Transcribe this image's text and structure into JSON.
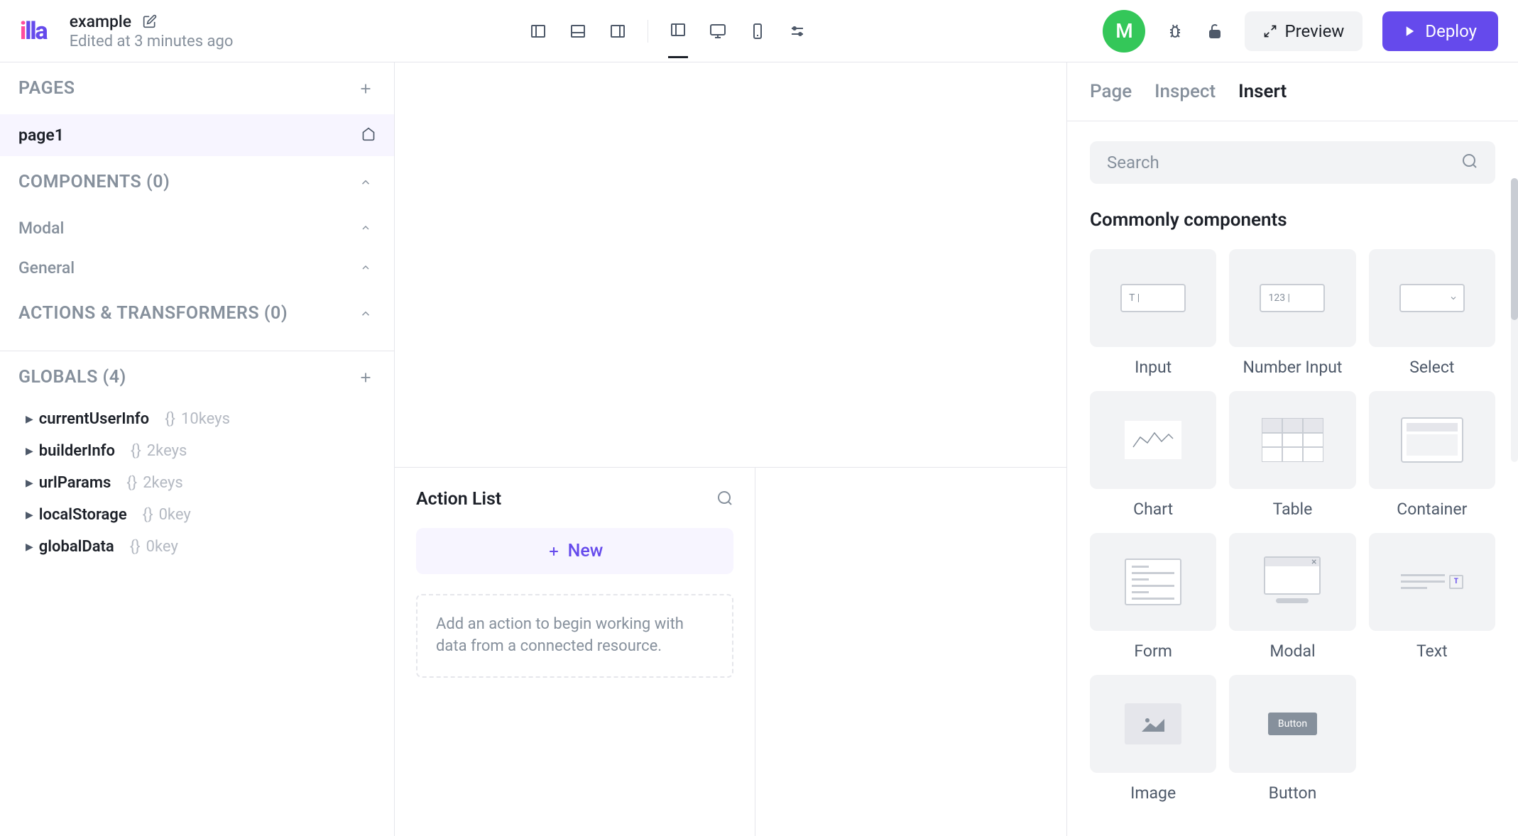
{
  "header": {
    "project_name": "example",
    "edited_at": "Edited at 3 minutes ago",
    "avatar_letter": "M",
    "preview_label": "Preview",
    "deploy_label": "Deploy"
  },
  "left_panel": {
    "pages": {
      "title": "PAGES",
      "items": [
        {
          "name": "page1"
        }
      ]
    },
    "components": {
      "title": "COMPONENTS (0)",
      "subsections": [
        {
          "title": "Modal"
        },
        {
          "title": "General"
        }
      ]
    },
    "actions_transformers": {
      "title": "ACTIONS & TRANSFORMERS (0)"
    },
    "globals": {
      "title": "GLOBALS (4)",
      "items": [
        {
          "name": "currentUserInfo",
          "type": "{}",
          "keys": "10keys"
        },
        {
          "name": "builderInfo",
          "type": "{}",
          "keys": "2keys"
        },
        {
          "name": "urlParams",
          "type": "{}",
          "keys": "2keys"
        },
        {
          "name": "localStorage",
          "type": "{}",
          "keys": "0key"
        },
        {
          "name": "globalData",
          "type": "{}",
          "keys": "0key"
        }
      ]
    }
  },
  "action_panel": {
    "title": "Action List",
    "new_label": "New",
    "hint": "Add an action to begin working with data from a connected resource."
  },
  "right_panel": {
    "tabs": [
      {
        "label": "Page",
        "active": false
      },
      {
        "label": "Inspect",
        "active": false
      },
      {
        "label": "Insert",
        "active": true
      }
    ],
    "search_placeholder": "Search",
    "commonly_title": "Commonly components",
    "components": [
      {
        "label": "Input",
        "type": "input",
        "hint": "T |"
      },
      {
        "label": "Number Input",
        "type": "number_input",
        "hint": "123 |"
      },
      {
        "label": "Select",
        "type": "select"
      },
      {
        "label": "Chart",
        "type": "chart"
      },
      {
        "label": "Table",
        "type": "table"
      },
      {
        "label": "Container",
        "type": "container"
      },
      {
        "label": "Form",
        "type": "form"
      },
      {
        "label": "Modal",
        "type": "modal"
      },
      {
        "label": "Text",
        "type": "text"
      },
      {
        "label": "Image",
        "type": "image"
      },
      {
        "label": "Button",
        "type": "button",
        "hint": "Button"
      }
    ]
  }
}
